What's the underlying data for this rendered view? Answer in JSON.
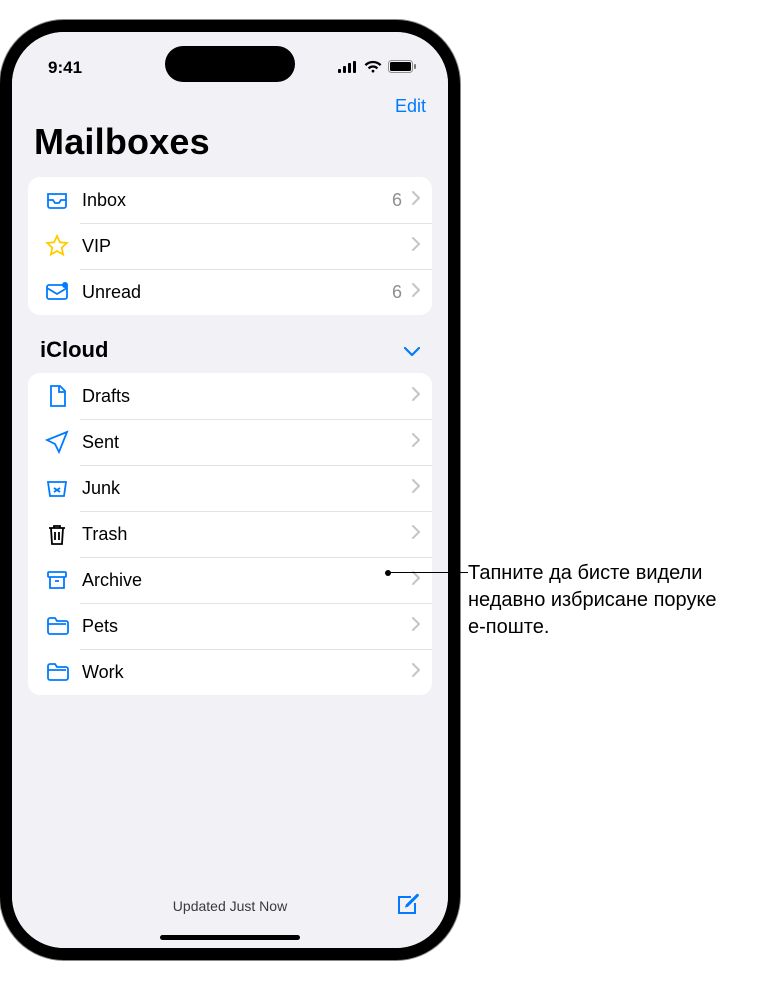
{
  "status": {
    "time": "9:41"
  },
  "nav": {
    "edit_label": "Edit"
  },
  "title": "Mailboxes",
  "primary": [
    {
      "icon": "inbox",
      "label": "Inbox",
      "count": "6"
    },
    {
      "icon": "star",
      "label": "VIP",
      "count": ""
    },
    {
      "icon": "unread",
      "label": "Unread",
      "count": "6"
    }
  ],
  "section": {
    "title": "iCloud"
  },
  "icloud": [
    {
      "icon": "doc",
      "label": "Drafts"
    },
    {
      "icon": "send",
      "label": "Sent"
    },
    {
      "icon": "junk",
      "label": "Junk"
    },
    {
      "icon": "trash",
      "label": "Trash"
    },
    {
      "icon": "archive",
      "label": "Archive"
    },
    {
      "icon": "folder",
      "label": "Pets"
    },
    {
      "icon": "folder",
      "label": "Work"
    }
  ],
  "toolbar": {
    "status": "Updated Just Now"
  },
  "callout": {
    "text": "Тапните да бисте видели недавно избрисане поруке е-поште."
  }
}
